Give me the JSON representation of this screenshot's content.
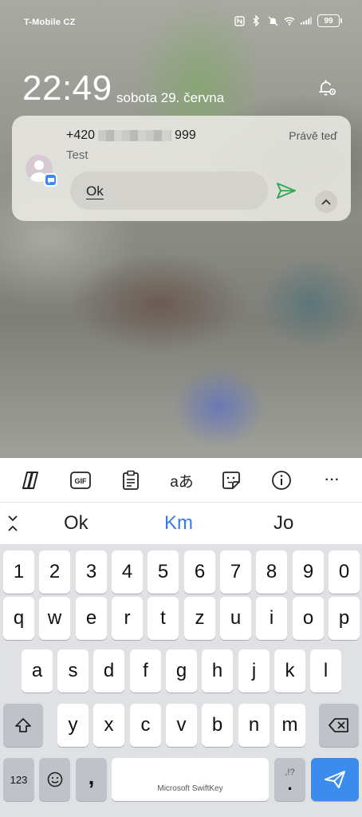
{
  "status_bar": {
    "carrier": "T-Mobile CZ",
    "battery": "99",
    "icons": [
      "nfc-icon",
      "bluetooth-icon",
      "mute-icon",
      "wifi-icon",
      "signal-icon",
      "battery-icon"
    ]
  },
  "lock_screen": {
    "time": "22:49",
    "date": "sobota 29. června"
  },
  "notification": {
    "sender_prefix": "+420",
    "sender_suffix": "999",
    "time": "Právě teď",
    "message": "Test",
    "reply_text": "Ok",
    "colors": {
      "send": "#2eaa55",
      "badge": "#3d8af0"
    }
  },
  "keyboard": {
    "toolbar_icons": [
      "copilot-icon",
      "gif-icon",
      "clipboard-icon",
      "translate-icon",
      "sticker-icon",
      "info-icon",
      "more-icon"
    ],
    "toolbar_gif": "GIF",
    "toolbar_translate": "aあ",
    "toolbar_more": "···",
    "suggestions": [
      "Ok",
      "Km",
      "Jo"
    ],
    "row_numbers": [
      "1",
      "2",
      "3",
      "4",
      "5",
      "6",
      "7",
      "8",
      "9",
      "0"
    ],
    "row_1": [
      "q",
      "w",
      "e",
      "r",
      "t",
      "z",
      "u",
      "i",
      "o",
      "p"
    ],
    "row_2": [
      "a",
      "s",
      "d",
      "f",
      "g",
      "h",
      "j",
      "k",
      "l"
    ],
    "row_3": [
      "y",
      "x",
      "c",
      "v",
      "b",
      "n",
      "m"
    ],
    "key_123": "123",
    "key_comma": ",",
    "key_period": ".",
    "key_period_alt": ",!?",
    "space_label": "Microsoft SwiftKey",
    "colors": {
      "accent": "#3b7be0",
      "enter": "#3b8ced"
    }
  }
}
